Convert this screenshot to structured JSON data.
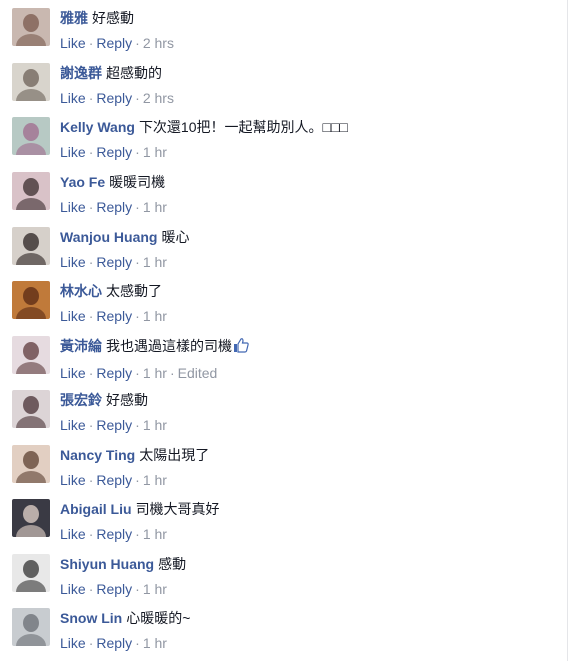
{
  "actions": {
    "like": "Like",
    "reply": "Reply",
    "separator": "·",
    "edited": "Edited"
  },
  "comments": [
    {
      "author": "雅雅",
      "text": "好感動",
      "time": "2 hrs",
      "avatar_colors": [
        "#c9b8b0",
        "#7a5a4e"
      ]
    },
    {
      "author": "謝逸群",
      "text": "超感動的",
      "time": "2 hrs",
      "avatar_colors": [
        "#d8d4cc",
        "#6d6258"
      ]
    },
    {
      "author": "Kelly Wang",
      "text": "下次還10把！一起幫助別人。□□□",
      "time": "1 hr",
      "avatar_colors": [
        "#b7c9c4",
        "#a06a8e"
      ]
    },
    {
      "author": "Yao Fe",
      "text": "暖暖司機",
      "time": "1 hr",
      "avatar_colors": [
        "#d9c2c8",
        "#3a2c2e"
      ]
    },
    {
      "author": "Wanjou Huang",
      "text": "暖心",
      "time": "1 hr",
      "avatar_colors": [
        "#d6d0ca",
        "#2a2220"
      ]
    },
    {
      "author": "林水心",
      "text": "太感動了",
      "time": "1 hr",
      "avatar_colors": [
        "#c07a3a",
        "#5a2a14"
      ]
    },
    {
      "author": "黃沛綸",
      "text": "我也遇過這樣的司機",
      "time": "1 hr",
      "edited": true,
      "thumbs_up": true,
      "avatar_colors": [
        "#e6dbe0",
        "#5e3a3c"
      ]
    },
    {
      "author": "張宏鈴",
      "text": "好感動",
      "time": "1 hr",
      "avatar_colors": [
        "#dcd4d6",
        "#4a3236"
      ]
    },
    {
      "author": "Nancy Ting",
      "text": "太陽出現了",
      "time": "1 hr",
      "avatar_colors": [
        "#e2cfc2",
        "#5c4030"
      ]
    },
    {
      "author": "Abigail Liu",
      "text": "司機大哥真好",
      "time": "1 hr",
      "avatar_colors": [
        "#3a3a44",
        "#e6d6cc"
      ]
    },
    {
      "author": "Shiyun Huang",
      "text": "感動",
      "time": "1 hr",
      "avatar_colors": [
        "#e8e8e8",
        "#333333"
      ]
    },
    {
      "author": "Snow Lin",
      "text": "心暖暖的~",
      "time": "1 hr",
      "avatar_colors": [
        "#c8ccd0",
        "#6a6e74"
      ]
    }
  ],
  "colors": {
    "author": "#3b5998",
    "text": "#141823",
    "meta": "#9197a3"
  }
}
